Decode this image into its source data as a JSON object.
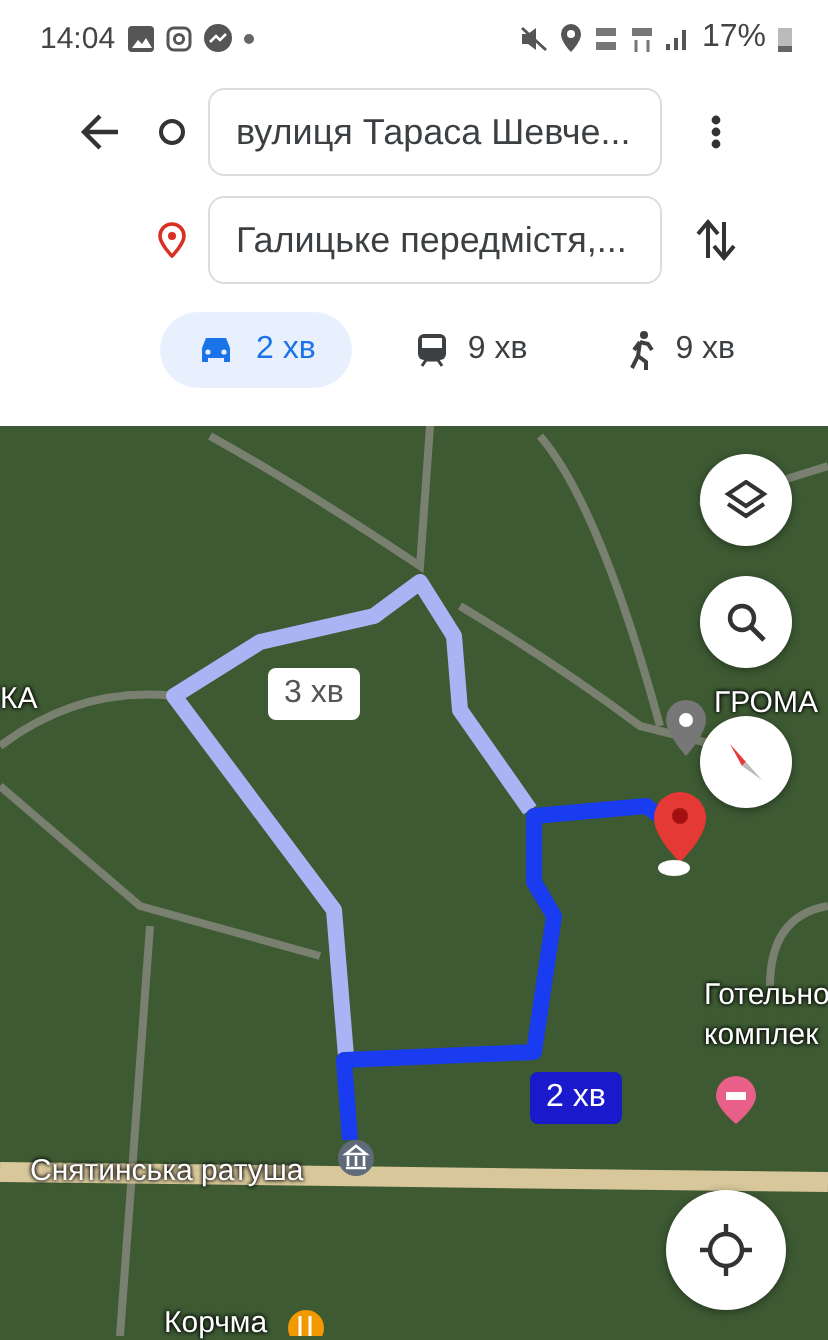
{
  "status_bar": {
    "time": "14:04",
    "battery": "17%"
  },
  "route": {
    "origin": "вулиця Тараса Шевче...",
    "destination": "Галицьке передмістя,..."
  },
  "modes": [
    {
      "kind": "car",
      "label": "2 хв",
      "selected": true
    },
    {
      "kind": "transit",
      "label": "9 хв",
      "selected": false
    },
    {
      "kind": "walk",
      "label": "9 хв",
      "selected": false
    }
  ],
  "map": {
    "route_labels": [
      {
        "kind": "alternate",
        "text": "3 хв"
      },
      {
        "kind": "primary",
        "text": "2 хв"
      }
    ],
    "place_labels": [
      "КА",
      "ГРОМА",
      "Готельно",
      "комплек",
      "Снятинська ратуша",
      "Корчма"
    ]
  }
}
